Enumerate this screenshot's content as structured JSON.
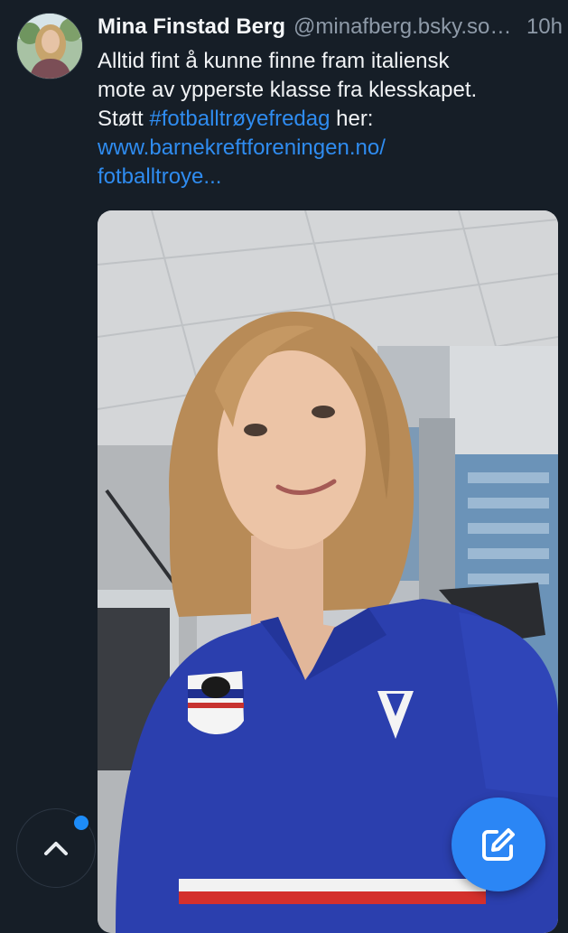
{
  "post": {
    "author": {
      "display_name": "Mina Finstad Berg",
      "handle": "@minafberg.bsky.social",
      "avatar_icon": "profile-photo"
    },
    "timestamp": "10h",
    "text_lines": [
      "Alltid fint å kunne finne fram italiensk",
      "mote av ypperste klasse fra klesskapet.",
      "Støtt"
    ],
    "hashtag": "#fotballtrøyefredag",
    "after_hashtag": " her:",
    "link_lines": [
      "www.barnekreftforeningen.no/",
      "fotballtroye..."
    ],
    "image_icon": "selfie-photo-blue-football-shirt"
  },
  "controls": {
    "scroll_top_icon": "chevron-up-icon",
    "compose_icon": "compose-icon",
    "has_unread": true
  },
  "colors": {
    "background": "#161e27",
    "link": "#2f8cf0",
    "accent": "#2b86f5",
    "muted_text": "#8e9aa8"
  }
}
